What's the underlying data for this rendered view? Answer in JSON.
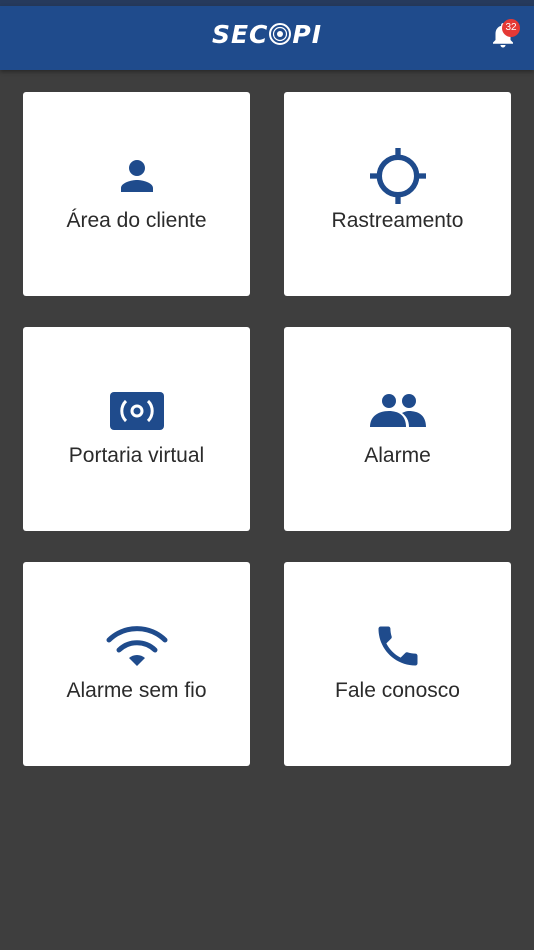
{
  "header": {
    "logo_left": "SEC",
    "logo_right": "PI",
    "notification_count": "32",
    "background_color": "#1f4b8c"
  },
  "tiles": [
    {
      "label": "Área do cliente",
      "icon": "person-icon"
    },
    {
      "label": "Rastreamento",
      "icon": "crosshair-icon"
    },
    {
      "label": "Portaria virtual",
      "icon": "camera-sensor-icon"
    },
    {
      "label": "Alarme",
      "icon": "people-icon"
    },
    {
      "label": "Alarme sem fio",
      "icon": "wifi-icon"
    },
    {
      "label": "Fale conosco",
      "icon": "phone-icon"
    }
  ],
  "colors": {
    "icon": "#1f4b8c",
    "background": "#3e3e3e",
    "tile": "#ffffff",
    "badge": "#e53935"
  }
}
